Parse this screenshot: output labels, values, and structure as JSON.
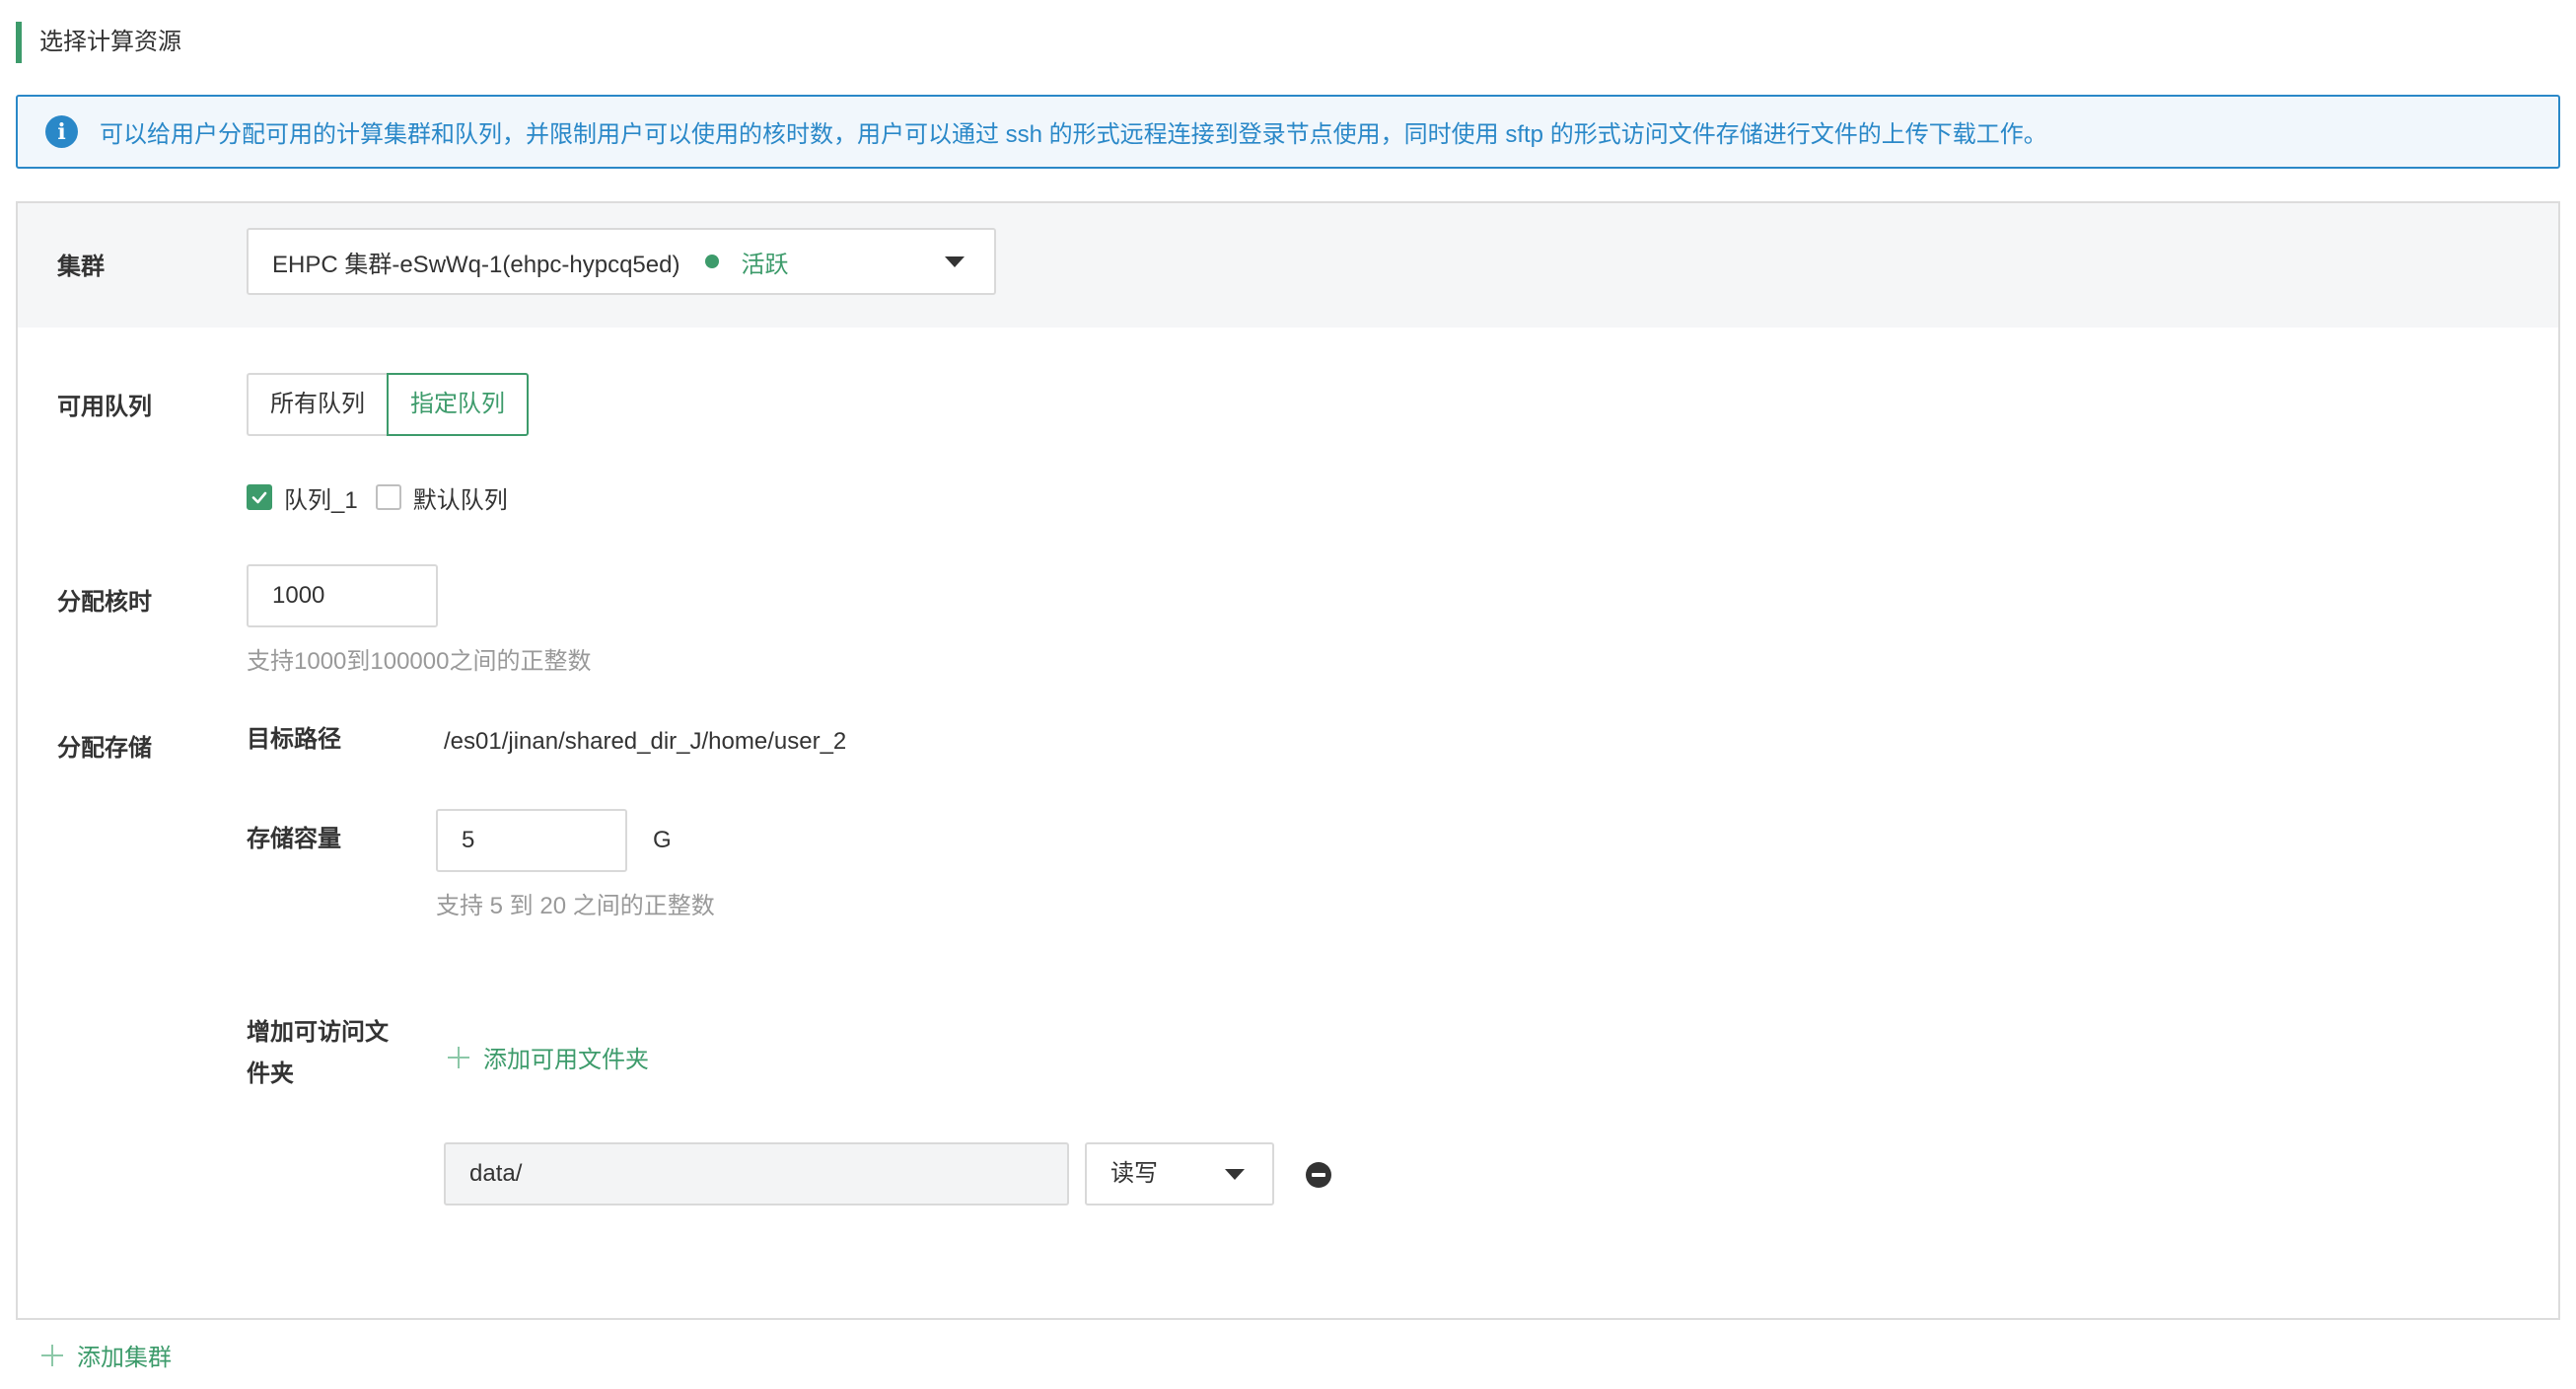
{
  "section": {
    "title": "选择计算资源"
  },
  "info": {
    "icon": "info-icon",
    "text": "可以给用户分配可用的计算集群和队列，并限制用户可以使用的核时数，用户可以通过 ssh 的形式远程连接到登录节点使用，同时使用 sftp 的形式访问文件存储进行文件的上传下载工作。"
  },
  "cluster": {
    "label": "集群",
    "selected": "EHPC 集群-eSwWq-1(ehpc-hypcq5ed)",
    "status": "活跃",
    "status_color": "#3d9b6b"
  },
  "queues": {
    "label": "可用队列",
    "options": [
      "所有队列",
      "指定队列"
    ],
    "active_option": "指定队列",
    "items": [
      {
        "label": "队列_1",
        "checked": true
      },
      {
        "label": "默认队列",
        "checked": false
      }
    ]
  },
  "core_hours": {
    "label": "分配核时",
    "value": "1000",
    "hint": "支持1000到100000之间的正整数"
  },
  "storage": {
    "label": "分配存储",
    "path_label": "目标路径",
    "path_value": "/es01/jinan/shared_dir_J/home/user_2",
    "capacity_label": "存储容量",
    "capacity_value": "5",
    "capacity_unit": "G",
    "capacity_hint": "支持 5 到 20 之间的正整数",
    "folders_label_line1": "增加可访问文",
    "folders_label_line2": "件夹",
    "add_folder": "添加可用文件夹",
    "folder": {
      "path": "data/",
      "permission": "读写"
    }
  },
  "add_cluster": "添加集群",
  "theme": {
    "accent": "#3d9b6b",
    "info": "#2a88c8"
  }
}
